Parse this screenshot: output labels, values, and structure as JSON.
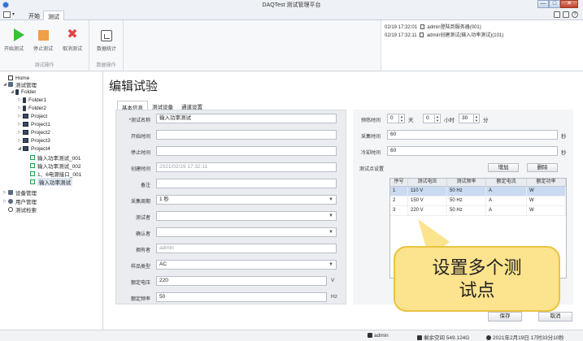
{
  "window": {
    "title": "DAQTest 测试管理平台",
    "min_label": "—",
    "max_label": "□",
    "close_label": "✕"
  },
  "ribbon": {
    "qa_arrow": "▾",
    "tabs": [
      {
        "label": "开始",
        "active": false
      },
      {
        "label": "测试",
        "active": true
      }
    ],
    "help_label": "?",
    "groups": [
      {
        "label": "测试操作",
        "buttons": [
          "开始测试",
          "停止测试",
          "取消测试"
        ]
      },
      {
        "label": "数据操作",
        "buttons": [
          "数据统计"
        ]
      }
    ]
  },
  "log": [
    {
      "time": "02/19 17:32:01",
      "text": "admin登陆到服务器(001)"
    },
    {
      "time": "02/19 17:32:11",
      "text": "admin创建测试(输入功率测试)(101)"
    }
  ],
  "tree": {
    "items": [
      {
        "label": "Home",
        "depth": 0,
        "icon": "home-icon",
        "arrow": ""
      },
      {
        "label": "测试管理",
        "depth": 0,
        "icon": "test-manage-icon",
        "arrow": "◢"
      },
      {
        "label": "Folder",
        "depth": 1,
        "icon": "folder-icon",
        "arrow": "◢"
      },
      {
        "label": "Folder1",
        "depth": 2,
        "icon": "folder-icon",
        "arrow": "▷"
      },
      {
        "label": "Folder2",
        "depth": 2,
        "icon": "folder-icon",
        "arrow": "▷"
      },
      {
        "label": "Project",
        "depth": 2,
        "icon": "project-icon",
        "arrow": "▷"
      },
      {
        "label": "Project1",
        "depth": 2,
        "icon": "project-icon",
        "arrow": "▷"
      },
      {
        "label": "Project2",
        "depth": 2,
        "icon": "project-icon",
        "arrow": "▷"
      },
      {
        "label": "Project3",
        "depth": 2,
        "icon": "project-icon",
        "arrow": "▷"
      },
      {
        "label": "Project4",
        "depth": 2,
        "icon": "project-icon",
        "arrow": "◢"
      },
      {
        "label": "输入功率测试_001",
        "depth": 3,
        "icon": "test-icon",
        "arrow": ""
      },
      {
        "label": "输入功率测试_002",
        "depth": 3,
        "icon": "test-icon",
        "arrow": ""
      },
      {
        "label": "1、6电源接口_001",
        "depth": 3,
        "icon": "test-icon",
        "arrow": ""
      },
      {
        "label": "输入功率测试",
        "depth": 3,
        "icon": "test-icon",
        "arrow": "",
        "selected": true
      },
      {
        "label": "设备管理",
        "depth": 0,
        "icon": "device-manage-icon",
        "arrow": "▷"
      },
      {
        "label": "用户管理",
        "depth": 0,
        "icon": "user-manage-icon",
        "arrow": "▷"
      },
      {
        "label": "测试检索",
        "depth": 0,
        "icon": "search-icon",
        "arrow": ""
      }
    ]
  },
  "main": {
    "title": "编辑试验",
    "tabs": [
      {
        "label": "基本信息",
        "active": true
      },
      {
        "label": "测试设备",
        "active": false
      },
      {
        "label": "通道设置",
        "active": false
      }
    ],
    "form": {
      "fields": [
        {
          "key": "name",
          "label": "*测试名称",
          "value": "输入功率测试",
          "type": "text"
        },
        {
          "key": "start",
          "label": "开始时间",
          "value": "",
          "type": "text"
        },
        {
          "key": "stop",
          "label": "停止时间",
          "value": "",
          "type": "text"
        },
        {
          "key": "created",
          "label": "创建时间",
          "value": "2021/02/19 17:32:11",
          "type": "readonly"
        },
        {
          "key": "note",
          "label": "备注",
          "value": "",
          "type": "text"
        },
        {
          "key": "period",
          "label": "采集周期",
          "value": "1 秒",
          "type": "select"
        },
        {
          "key": "tester",
          "label": "测试者",
          "value": "",
          "type": "select"
        },
        {
          "key": "confirmer",
          "label": "确认者",
          "value": "",
          "type": "select"
        },
        {
          "key": "owner",
          "label": "拥有者",
          "value": "admin",
          "type": "readonly"
        },
        {
          "key": "sample_type",
          "label": "样品类型",
          "value": "AC",
          "type": "select"
        },
        {
          "key": "voltage",
          "label": "额定电压",
          "value": "220",
          "type": "text",
          "unit": "V"
        },
        {
          "key": "frequency",
          "label": "额定频率",
          "value": "50",
          "type": "text",
          "unit": "Hz"
        }
      ]
    },
    "right": {
      "preheat": {
        "label": "预热时间",
        "values": [
          {
            "value": "0",
            "unit": "天"
          },
          {
            "value": "0",
            "unit": "小时"
          },
          {
            "value": "30",
            "unit": "分"
          }
        ]
      },
      "collect_time": {
        "label": "采集时间",
        "value": "60",
        "unit": "秒"
      },
      "cool_time": {
        "label": "冷却时间",
        "value": "60",
        "unit": "秒"
      },
      "points_label": "测试点设置",
      "add_label": "增加",
      "delete_label": "删除",
      "table": {
        "headers": [
          "序号",
          "测试电压",
          "测试频率",
          "额定电流",
          "额定功率"
        ],
        "rows": [
          [
            "1",
            "110 V",
            "50 Hz",
            "A",
            "W"
          ],
          [
            "2",
            "150 V",
            "50 Hz",
            "A",
            "W"
          ],
          [
            "3",
            "220 V",
            "50 Hz",
            "A",
            "W"
          ]
        ],
        "selected_row": 0
      }
    },
    "save_label": "保存",
    "cancel_label": "取消"
  },
  "callout": {
    "line1": "设置多个测",
    "line2": "试点"
  },
  "statusbar": {
    "user": "admin",
    "disk": "剩余空间 549.124G",
    "datetime": "2021年2月19日 17时33分10秒"
  },
  "colors": {
    "accent": "#2b6fd6",
    "play": "#37c237",
    "stop": "#f0a04a",
    "cancel": "#e24444",
    "callout_bg": "#fce38d",
    "selected_row": "#c9daf1"
  }
}
